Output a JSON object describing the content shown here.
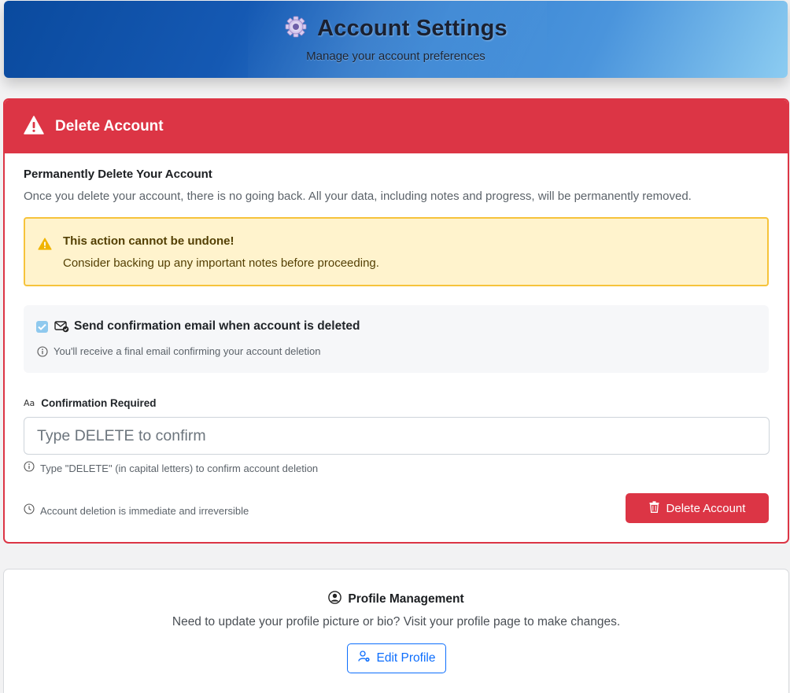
{
  "header": {
    "title": "Account Settings",
    "subtitle": "Manage your account preferences"
  },
  "delete_section": {
    "title": "Delete Account",
    "subtitle": "Permanently Delete Your Account",
    "description": "Once you delete your account, there is no going back. All your data, including notes and progress, will be permanently removed.",
    "warning": {
      "title": "This action cannot be undone!",
      "text": "Consider backing up any important notes before proceeding."
    },
    "email_option": {
      "checked": true,
      "label": "Send confirmation email when account is deleted",
      "help": "You'll receive a final email confirming your account deletion"
    },
    "confirmation": {
      "label": "Confirmation Required",
      "placeholder": "Type DELETE to confirm",
      "value": "",
      "help": "Type \"DELETE\" (in capital letters) to confirm account deletion"
    },
    "footer_note": "Account deletion is immediate and irreversible",
    "delete_button": "Delete Account"
  },
  "profile_section": {
    "title": "Profile Management",
    "description": "Need to update your profile picture or bio? Visit your profile page to make changes.",
    "edit_button": "Edit Profile"
  },
  "colors": {
    "danger": "#dc3545",
    "primary": "#0d6efd",
    "warning_bg": "#fff3cd",
    "warning_border": "#f6c33b"
  },
  "icons": {
    "header": "gear-icon",
    "danger": "warning-triangle-icon",
    "email": "envelope-check-icon",
    "info": "info-circle-icon",
    "text_format": "text-aa-icon",
    "clock": "clock-icon",
    "trash": "trash-icon",
    "user": "person-circle-icon",
    "edit_user": "person-gear-icon"
  }
}
